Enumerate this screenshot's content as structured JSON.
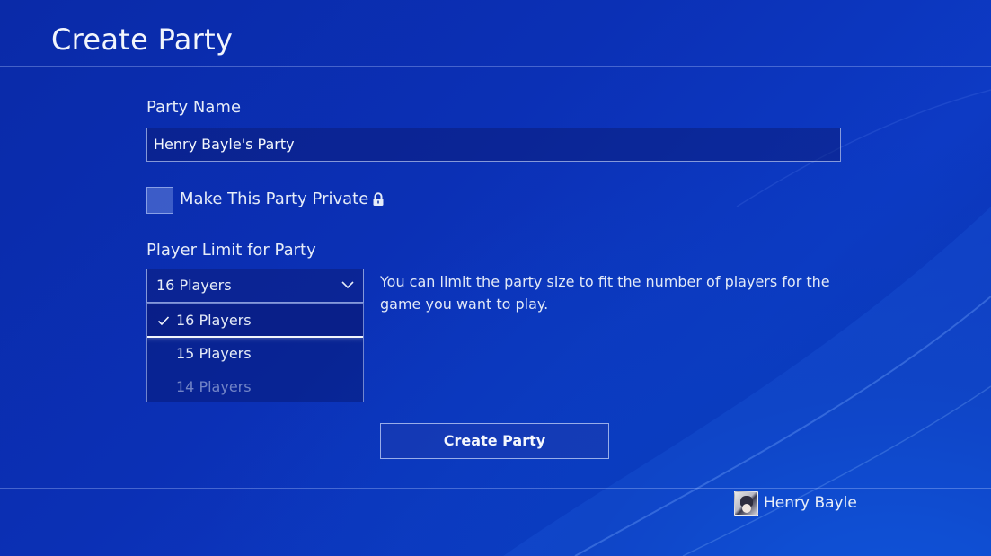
{
  "header": {
    "title": "Create Party"
  },
  "form": {
    "party_name_label": "Party Name",
    "party_name_value": "Henry Bayle's Party",
    "private_label": "Make This Party Private",
    "private_checked": false,
    "player_limit_label": "Player Limit for Party",
    "player_limit_selected": "16 Players",
    "player_limit_options": [
      {
        "label": "16 Players",
        "selected": true
      },
      {
        "label": "15 Players",
        "selected": false
      },
      {
        "label": "14 Players",
        "selected": false
      }
    ],
    "helper_text": "You can limit the party size to fit the number of players for the game you want to play.",
    "submit_label": "Create Party"
  },
  "footer": {
    "username": "Henry Bayle"
  },
  "icons": {
    "lock": "lock-icon",
    "chevron": "chevron-down-icon",
    "check": "checkmark-icon"
  },
  "colors": {
    "background": "#0b30b5",
    "accent_text": "#f2f5fc",
    "border": "#c8d7ff"
  }
}
